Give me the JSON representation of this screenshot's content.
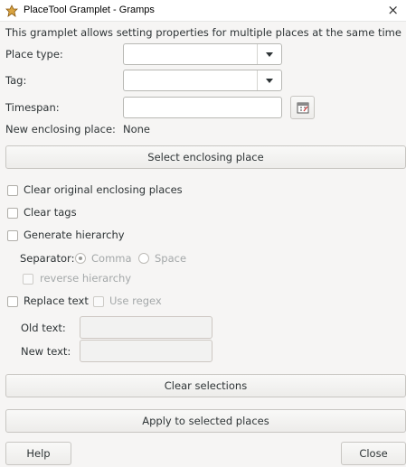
{
  "window": {
    "title": "PlaceTool Gramplet - Gramps",
    "close_glyph": "×"
  },
  "intro_text": "This gramplet allows setting properties for multiple places at the same time",
  "fields": {
    "place_type": {
      "label": "Place type:",
      "value": ""
    },
    "tag": {
      "label": "Tag:",
      "value": ""
    },
    "timespan": {
      "label": "Timespan:",
      "value": ""
    }
  },
  "enclosing": {
    "label": "New enclosing place:",
    "value": "None",
    "select_button": "Select enclosing place"
  },
  "options": {
    "clear_original": "Clear original enclosing places",
    "clear_tags": "Clear tags",
    "generate_hierarchy": "Generate hierarchy"
  },
  "separator": {
    "label": "Separator:",
    "comma": "Comma",
    "space": "Space",
    "selected": "Comma",
    "reverse_hierarchy": "reverse hierarchy"
  },
  "replace": {
    "replace_text": "Replace text",
    "use_regex": "Use regex",
    "old_label": "Old text:",
    "new_label": "New text:",
    "old_value": "",
    "new_value": ""
  },
  "buttons": {
    "clear_selections": "Clear selections",
    "apply": "Apply to selected places",
    "help": "Help",
    "close": "Close"
  },
  "icons": {
    "app": "gramps-app-icon",
    "date_editor": "date-editor-icon",
    "dropdown": "chevron-down-icon"
  }
}
